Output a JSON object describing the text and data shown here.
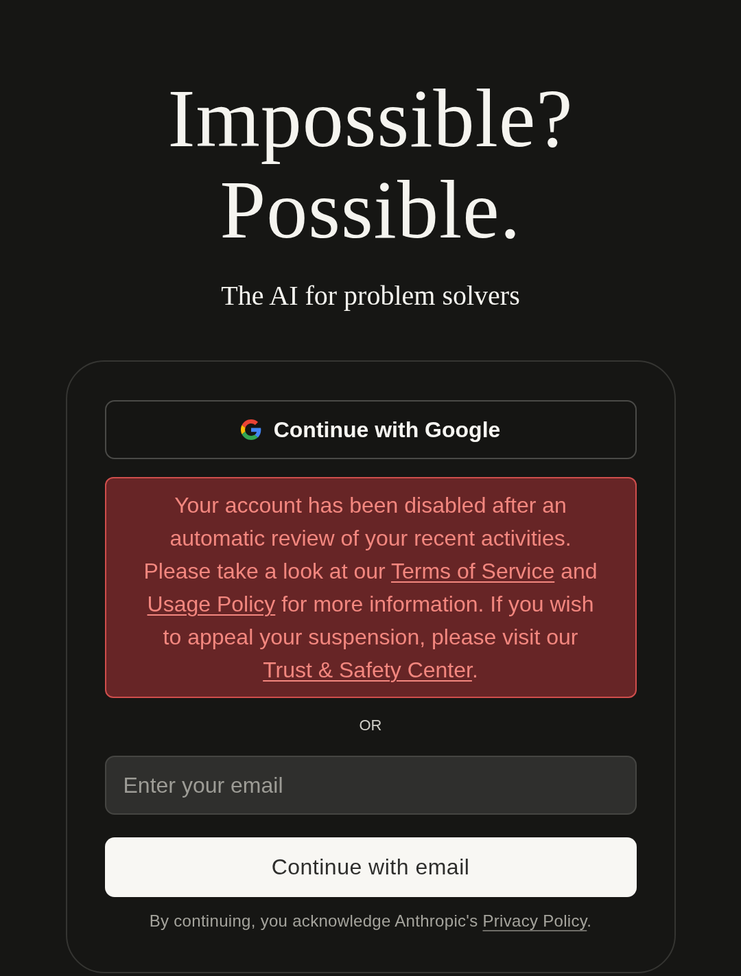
{
  "headline": {
    "lines": [
      "Impossible?",
      "Possible."
    ]
  },
  "tagline": "The AI for problem solvers",
  "sign_in": {
    "google_button": {
      "label": "Continue with Google"
    },
    "error": {
      "segments": [
        {
          "kind": "text",
          "text": "Your account has been disabled after an automatic review of your recent activities. Please take a look at our "
        },
        {
          "kind": "link",
          "text": "Terms of Service"
        },
        {
          "kind": "text",
          "text": " and "
        },
        {
          "kind": "link",
          "text": "Usage Policy"
        },
        {
          "kind": "text",
          "text": " for more information. If you wish to appeal your suspension, please visit our "
        },
        {
          "kind": "link",
          "text": "Trust & Safety Center"
        },
        {
          "kind": "text",
          "text": "."
        }
      ]
    },
    "divider": "OR",
    "email_field": {
      "placeholder": "Enter your email"
    },
    "email_button": {
      "label": "Continue with email"
    },
    "footer": {
      "segments": [
        {
          "kind": "text",
          "text": "By continuing, you acknowledge Anthropic's "
        },
        {
          "kind": "link",
          "text": "Privacy Policy"
        },
        {
          "kind": "text",
          "text": "."
        }
      ]
    }
  }
}
